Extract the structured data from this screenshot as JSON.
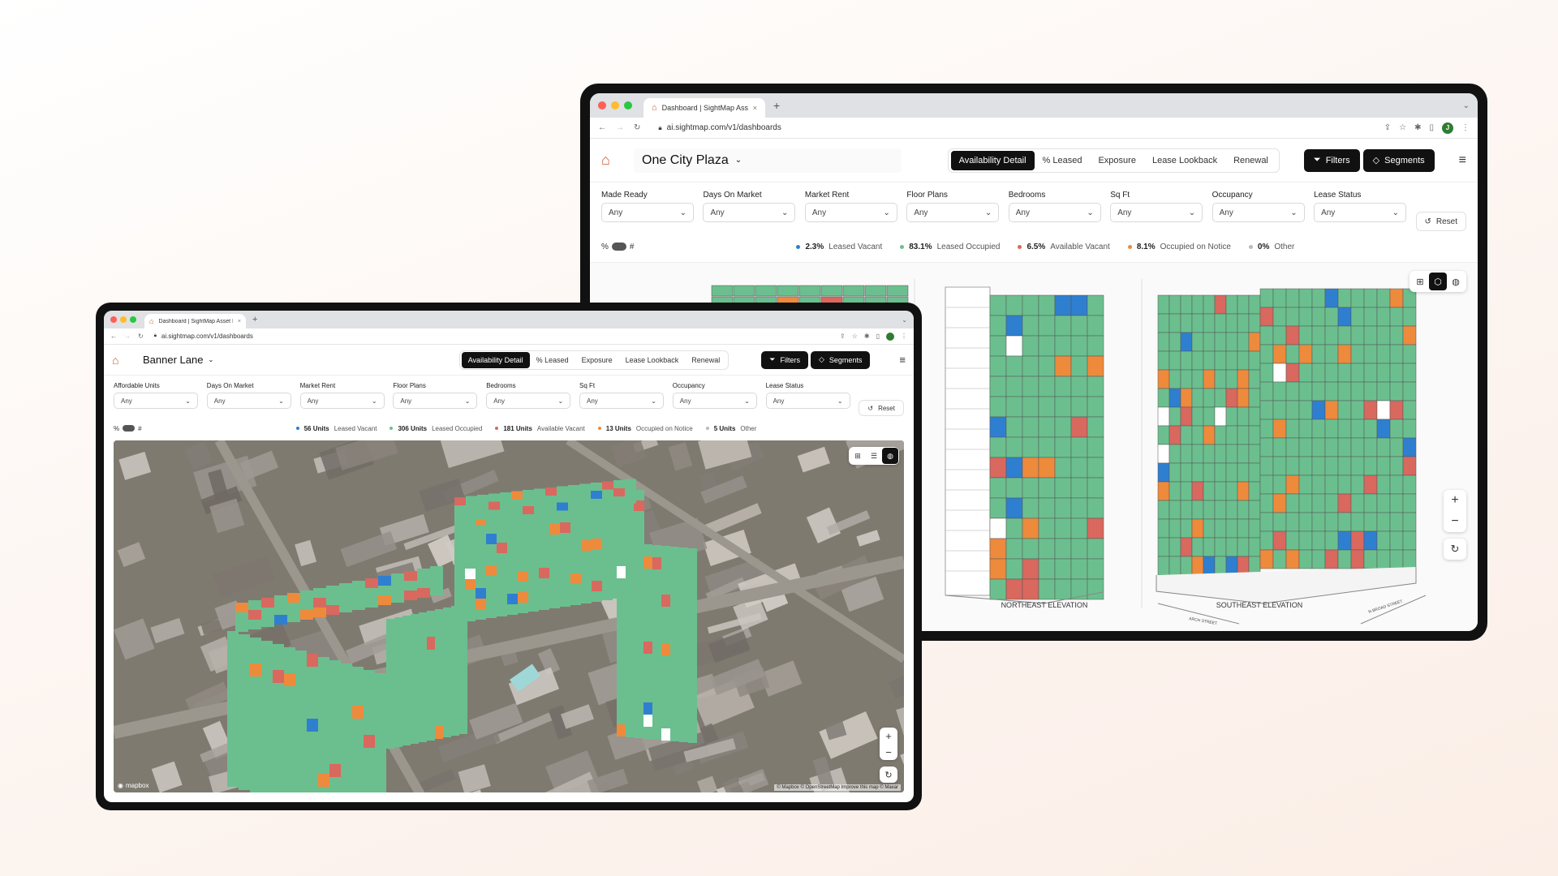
{
  "colors": {
    "leased_vacant": "#2f7fd0",
    "leased_occupied": "#6bbf8e",
    "available_vacant": "#d9685f",
    "occupied_on_notice": "#ee8a3c",
    "other": "#bbbbbb",
    "brand": "#c85a2c"
  },
  "back": {
    "tab_title": "Dashboard | SightMap Asset I...",
    "url": "ai.sightmap.com/v1/dashboards",
    "avatar": "J",
    "property": "One City Plaza",
    "views": [
      "Availability Detail",
      "% Leased",
      "Exposure",
      "Lease Lookback",
      "Renewal"
    ],
    "filters_label": "Filters",
    "segments_label": "Segments",
    "filters": [
      {
        "label": "Made Ready",
        "value": "Any"
      },
      {
        "label": "Days On Market",
        "value": "Any"
      },
      {
        "label": "Market Rent",
        "value": "Any"
      },
      {
        "label": "Floor Plans",
        "value": "Any"
      },
      {
        "label": "Bedrooms",
        "value": "Any"
      },
      {
        "label": "Sq Ft",
        "value": "Any"
      },
      {
        "label": "Occupancy",
        "value": "Any"
      },
      {
        "label": "Lease Status",
        "value": "Any"
      }
    ],
    "reset_label": "Reset",
    "toggle_pct": "%",
    "toggle_num": "#",
    "legend": [
      {
        "value": "2.3%",
        "label": "Leased Vacant"
      },
      {
        "value": "83.1%",
        "label": "Leased Occupied"
      },
      {
        "value": "6.5%",
        "label": "Available Vacant"
      },
      {
        "value": "8.1%",
        "label": "Occupied on Notice"
      },
      {
        "value": "0%",
        "label": "Other"
      }
    ],
    "elevation_left": "NORTHEAST ELEVATION",
    "elevation_right": "SOUTHEAST ELEVATION",
    "street_a": "ARCH STREET",
    "street_b": "N BROAD STREET"
  },
  "front": {
    "tab_title": "Dashboard | SightMap Asset I...",
    "url": "ai.sightmap.com/v1/dashboards",
    "property": "Banner Lane",
    "views": [
      "Availability Detail",
      "% Leased",
      "Exposure",
      "Lease Lookback",
      "Renewal"
    ],
    "filters_label": "Filters",
    "segments_label": "Segments",
    "filters": [
      {
        "label": "Affordable Units",
        "value": "Any"
      },
      {
        "label": "Days On Market",
        "value": "Any"
      },
      {
        "label": "Market Rent",
        "value": "Any"
      },
      {
        "label": "Floor Plans",
        "value": "Any"
      },
      {
        "label": "Bedrooms",
        "value": "Any"
      },
      {
        "label": "Sq Ft",
        "value": "Any"
      },
      {
        "label": "Occupancy",
        "value": "Any"
      },
      {
        "label": "Lease Status",
        "value": "Any"
      }
    ],
    "reset_label": "Reset",
    "toggle_pct": "%",
    "toggle_num": "#",
    "legend": [
      {
        "value": "56 Units",
        "label": "Leased Vacant"
      },
      {
        "value": "306 Units",
        "label": "Leased Occupied"
      },
      {
        "value": "181 Units",
        "label": "Available Vacant"
      },
      {
        "value": "13 Units",
        "label": "Occupied on Notice"
      },
      {
        "value": "5 Units",
        "label": "Other"
      }
    ],
    "mapbox": "mapbox",
    "attribution": "© Mapbox © OpenStreetMap Improve this map © Maxar"
  }
}
